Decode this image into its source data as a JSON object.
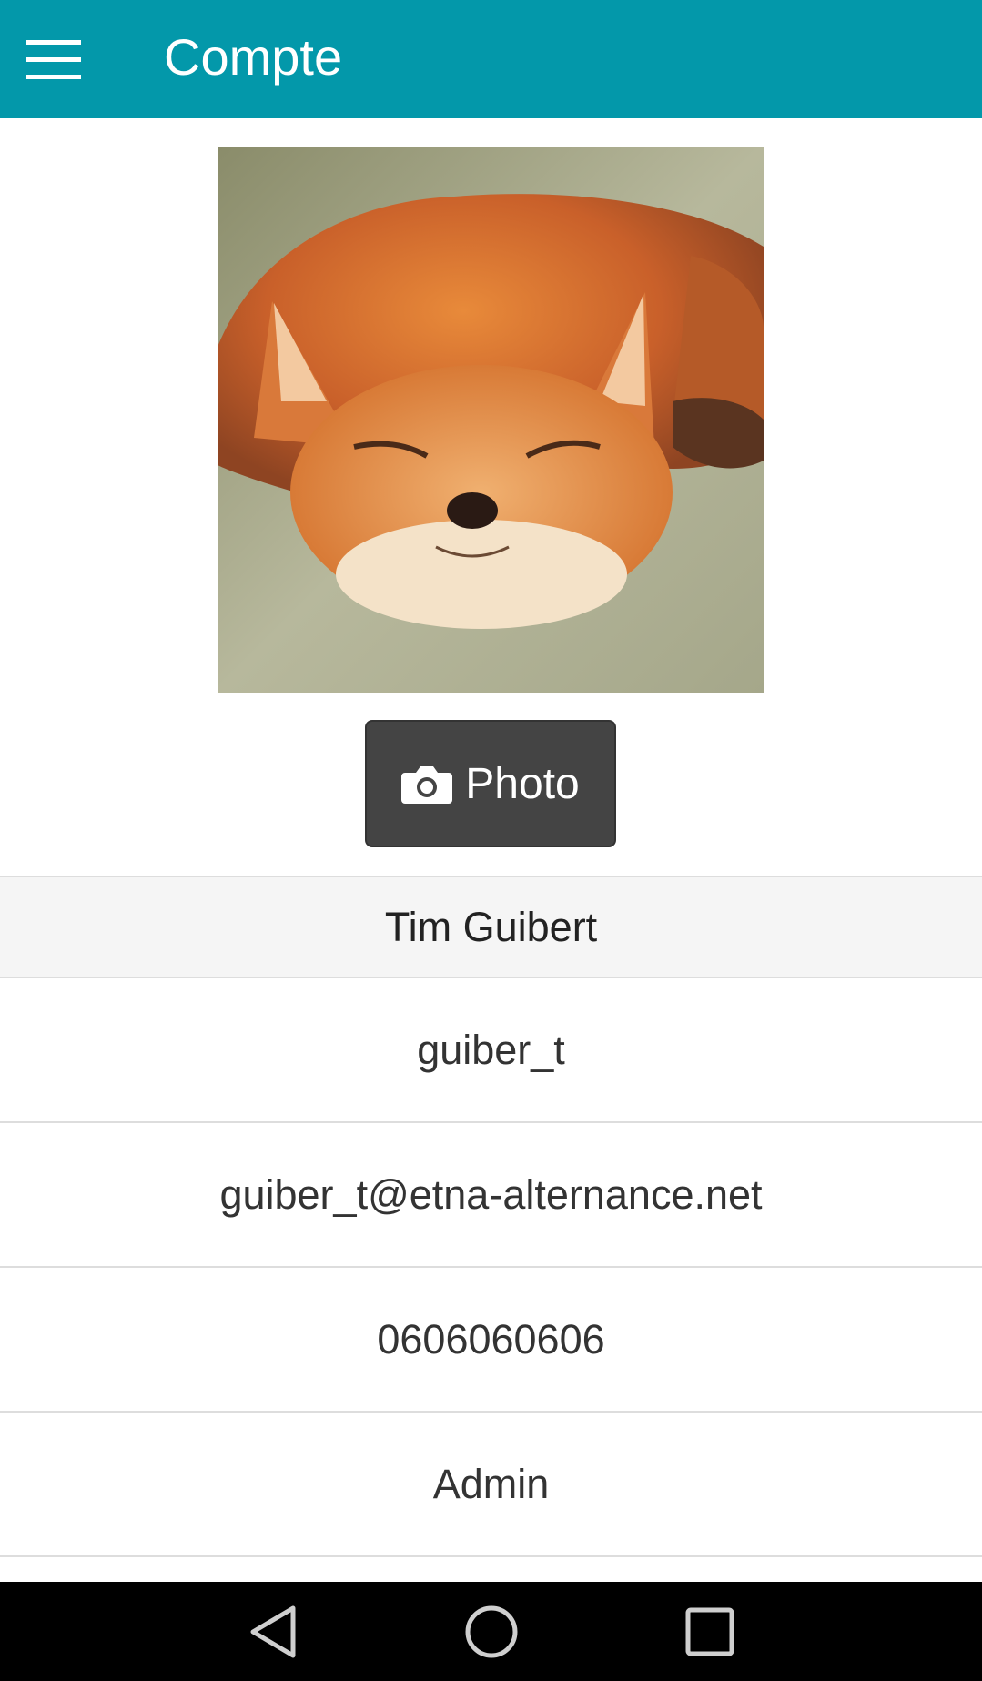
{
  "app_bar": {
    "title": "Compte",
    "menu_icon": "hamburger-menu-icon",
    "background": "#0398AA"
  },
  "profile": {
    "avatar_alt": "fox photo",
    "photo_button_label": "Photo",
    "photo_button_icon": "camera-icon",
    "name": "Tim Guibert",
    "fields": [
      "guiber_t",
      "guiber_t@etna-alternance.net",
      "0606060606",
      "Admin"
    ]
  },
  "system_nav": {
    "back_icon": "back-triangle-icon",
    "home_icon": "home-circle-icon",
    "recents_icon": "recents-square-icon"
  }
}
